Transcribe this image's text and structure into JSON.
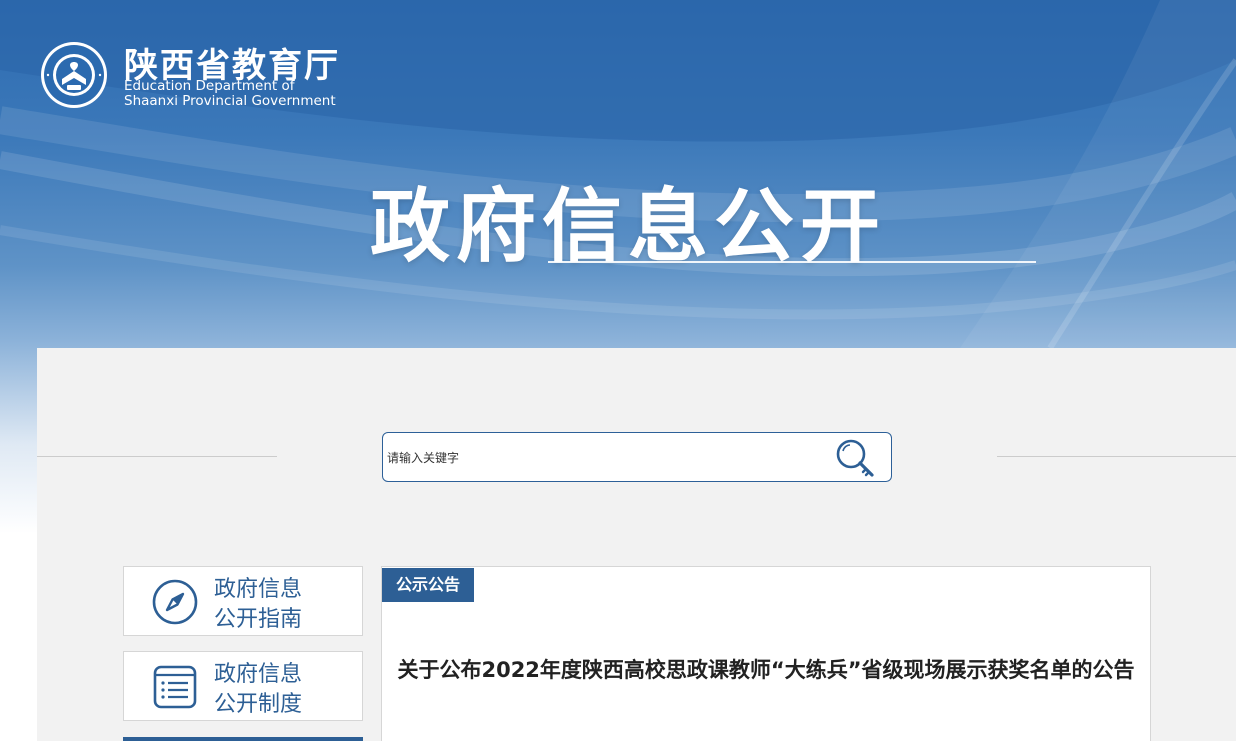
{
  "header": {
    "logo_icon": "eds-seal-icon",
    "site_name_cn": "陕西省教育厅",
    "site_name_en_line1": "Education Department of",
    "site_name_en_line2": "Shaanxi Provincial Government",
    "hero_title": "政府信息公开"
  },
  "search": {
    "placeholder": "请输入关键字",
    "icon": "search-icon"
  },
  "sidebar": {
    "items": [
      {
        "line1": "政府信息",
        "line2": "公开指南",
        "icon": "compass-icon"
      },
      {
        "line1": "政府信息",
        "line2": "公开制度",
        "icon": "document-list-icon"
      }
    ]
  },
  "content": {
    "tag": "公示公告",
    "article_title": "关于公布2022年度陕西高校思政课教师“大练兵”省级现场展示获奖名单的公告"
  },
  "colors": {
    "banner_top": "#2d6bb0",
    "accent": "#2d5f95",
    "panel_bg": "#f2f2f2"
  }
}
